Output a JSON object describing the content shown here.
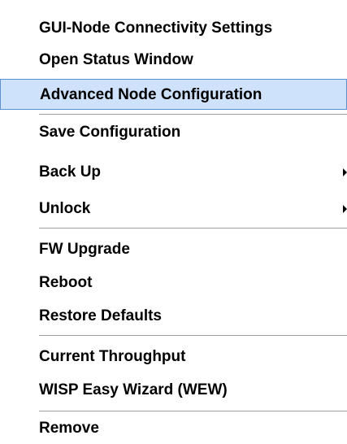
{
  "menu": {
    "items": [
      {
        "label": "GUI-Node Connectivity Settings"
      },
      {
        "label": "Open Status Window"
      },
      {
        "label": "Advanced Node Configuration",
        "highlighted": true
      },
      {
        "label": "Save Configuration"
      },
      {
        "label": "Back Up",
        "submenu": true
      },
      {
        "label": "Unlock",
        "submenu": true
      },
      {
        "label": "FW Upgrade"
      },
      {
        "label": "Reboot"
      },
      {
        "label": "Restore Defaults"
      },
      {
        "label": "Current Throughput"
      },
      {
        "label": "WISP Easy Wizard (WEW)"
      },
      {
        "label": "Remove"
      }
    ],
    "highlight_color": "#cfe2fb",
    "highlight_border_color": "#5d8fd8",
    "separator_color": "#a0a0a0"
  }
}
